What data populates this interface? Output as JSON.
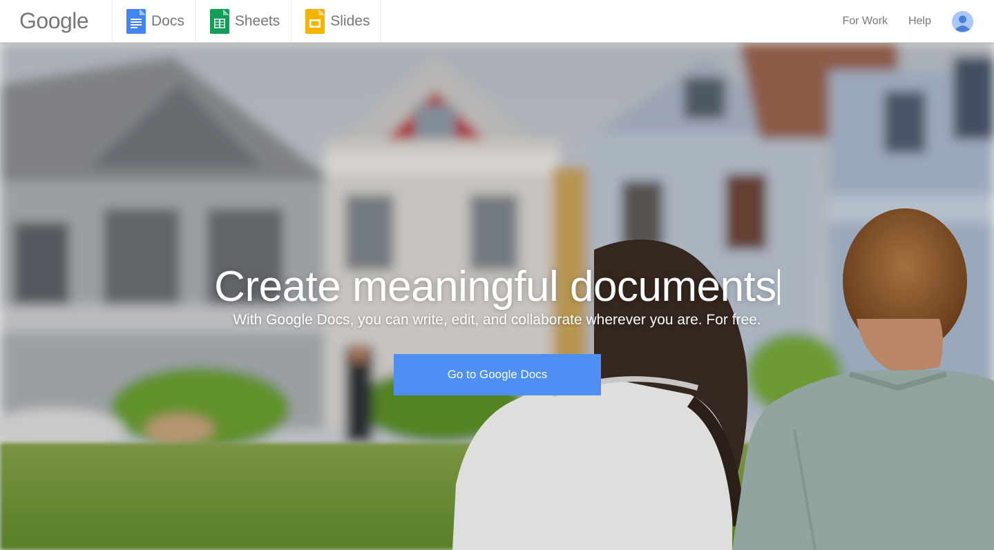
{
  "header": {
    "logo_text": "Google",
    "tabs": [
      {
        "label": "Docs",
        "icon": "docs-icon",
        "color": "#4285f4"
      },
      {
        "label": "Sheets",
        "icon": "sheets-icon",
        "color": "#0f9d58"
      },
      {
        "label": "Slides",
        "icon": "slides-icon",
        "color": "#f4b400"
      }
    ],
    "nav": {
      "for_work": "For Work",
      "help": "Help"
    },
    "avatar_icon": "account-avatar-icon"
  },
  "hero": {
    "headline": "Create meaningful documents",
    "subline": "With Google Docs, you can write, edit, and collaborate wherever you are. For free.",
    "cta_label": "Go to Google Docs",
    "cta_color": "#4d8ff5",
    "background": "photo-couple-on-lawn-victorian-houses"
  }
}
